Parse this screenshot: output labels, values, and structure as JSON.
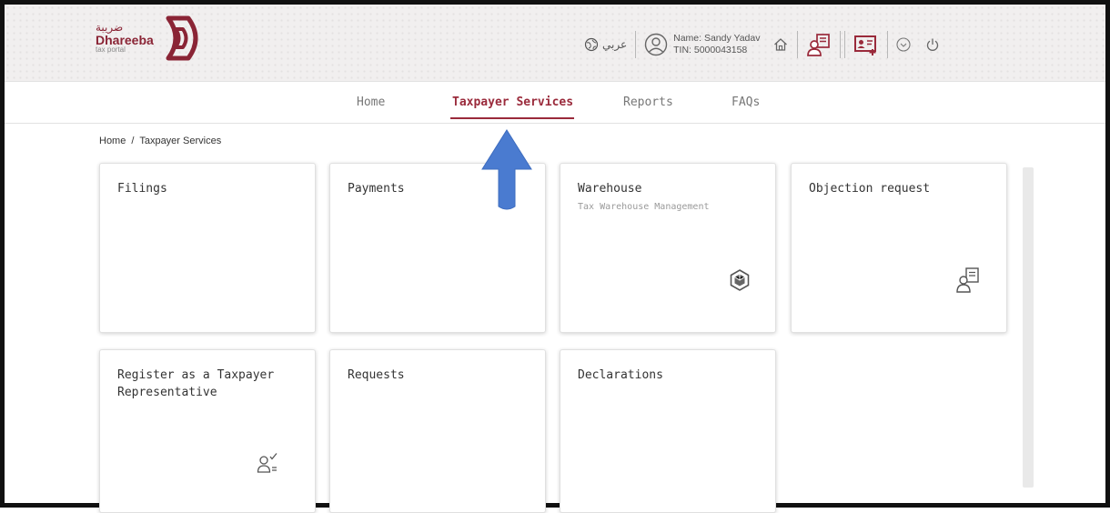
{
  "header": {
    "logo": {
      "arabic": "ضريبة",
      "english": "Dhareeba",
      "sub": "tax portal"
    },
    "language_label": "عربي",
    "user": {
      "name_line": "Name: Sandy Yadav",
      "tin_line": "TIN: 5000043158"
    }
  },
  "nav": {
    "items": [
      {
        "label": "Home"
      },
      {
        "label": "Taxpayer Services"
      },
      {
        "label": "Reports"
      },
      {
        "label": "FAQs"
      }
    ],
    "active": "Taxpayer Services"
  },
  "breadcrumb": {
    "home": "Home",
    "separator": "/",
    "current": "Taxpayer Services"
  },
  "cards": [
    {
      "title": "Filings",
      "subtitle": "",
      "icon": "none"
    },
    {
      "title": "Payments",
      "subtitle": "",
      "icon": "none"
    },
    {
      "title": "Warehouse",
      "subtitle": "Tax Warehouse Management",
      "icon": "cube-icon"
    },
    {
      "title": "Objection request",
      "subtitle": "",
      "icon": "objection-request-icon"
    },
    {
      "title": "Register as a Taxpayer Representative",
      "subtitle": "",
      "icon": "user-check-icon"
    },
    {
      "title": "Requests",
      "subtitle": "",
      "icon": "none"
    },
    {
      "title": "Declarations",
      "subtitle": "",
      "icon": "none"
    }
  ],
  "colors": {
    "brand": "#9a2a3b",
    "arrow": "#4a7bd0"
  }
}
